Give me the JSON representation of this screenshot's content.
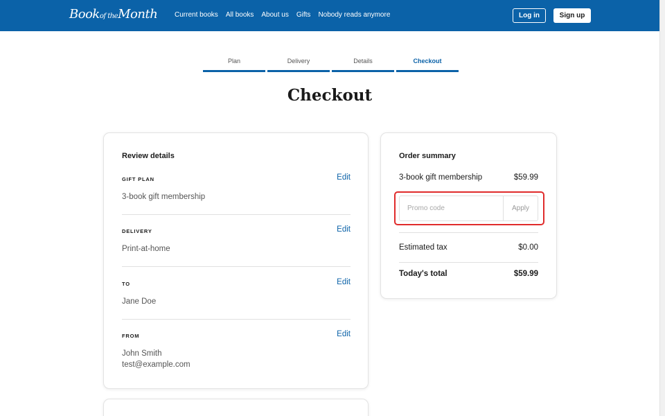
{
  "nav": {
    "logo_main": "Book",
    "logo_small": "of the",
    "logo_end": "Month",
    "links": [
      "Current books",
      "All books",
      "About us",
      "Gifts",
      "Nobody reads anymore"
    ],
    "login": "Log in",
    "signup": "Sign up",
    "color": "#0b62a8"
  },
  "steps": [
    "Plan",
    "Delivery",
    "Details",
    "Checkout"
  ],
  "active_step": "Checkout",
  "page_title": "Checkout",
  "review": {
    "title": "Review details",
    "edit_label": "Edit",
    "sections": [
      {
        "head": "GIFT PLAN",
        "value": "3-book gift membership"
      },
      {
        "head": "DELIVERY",
        "value": "Print-at-home"
      },
      {
        "head": "TO",
        "value": "Jane Doe"
      },
      {
        "head": "FROM",
        "value": "John Smith",
        "value2": "test@example.com"
      }
    ]
  },
  "summary": {
    "title": "Order summary",
    "item_label": "3-book gift membership",
    "item_price": "$59.99",
    "promo_placeholder": "Promo code",
    "promo_value": "",
    "apply_label": "Apply",
    "tax_label": "Estimated tax",
    "tax_value": "$0.00",
    "total_label": "Today's total",
    "total_value": "$59.99",
    "highlight_color": "#e02b2b"
  }
}
